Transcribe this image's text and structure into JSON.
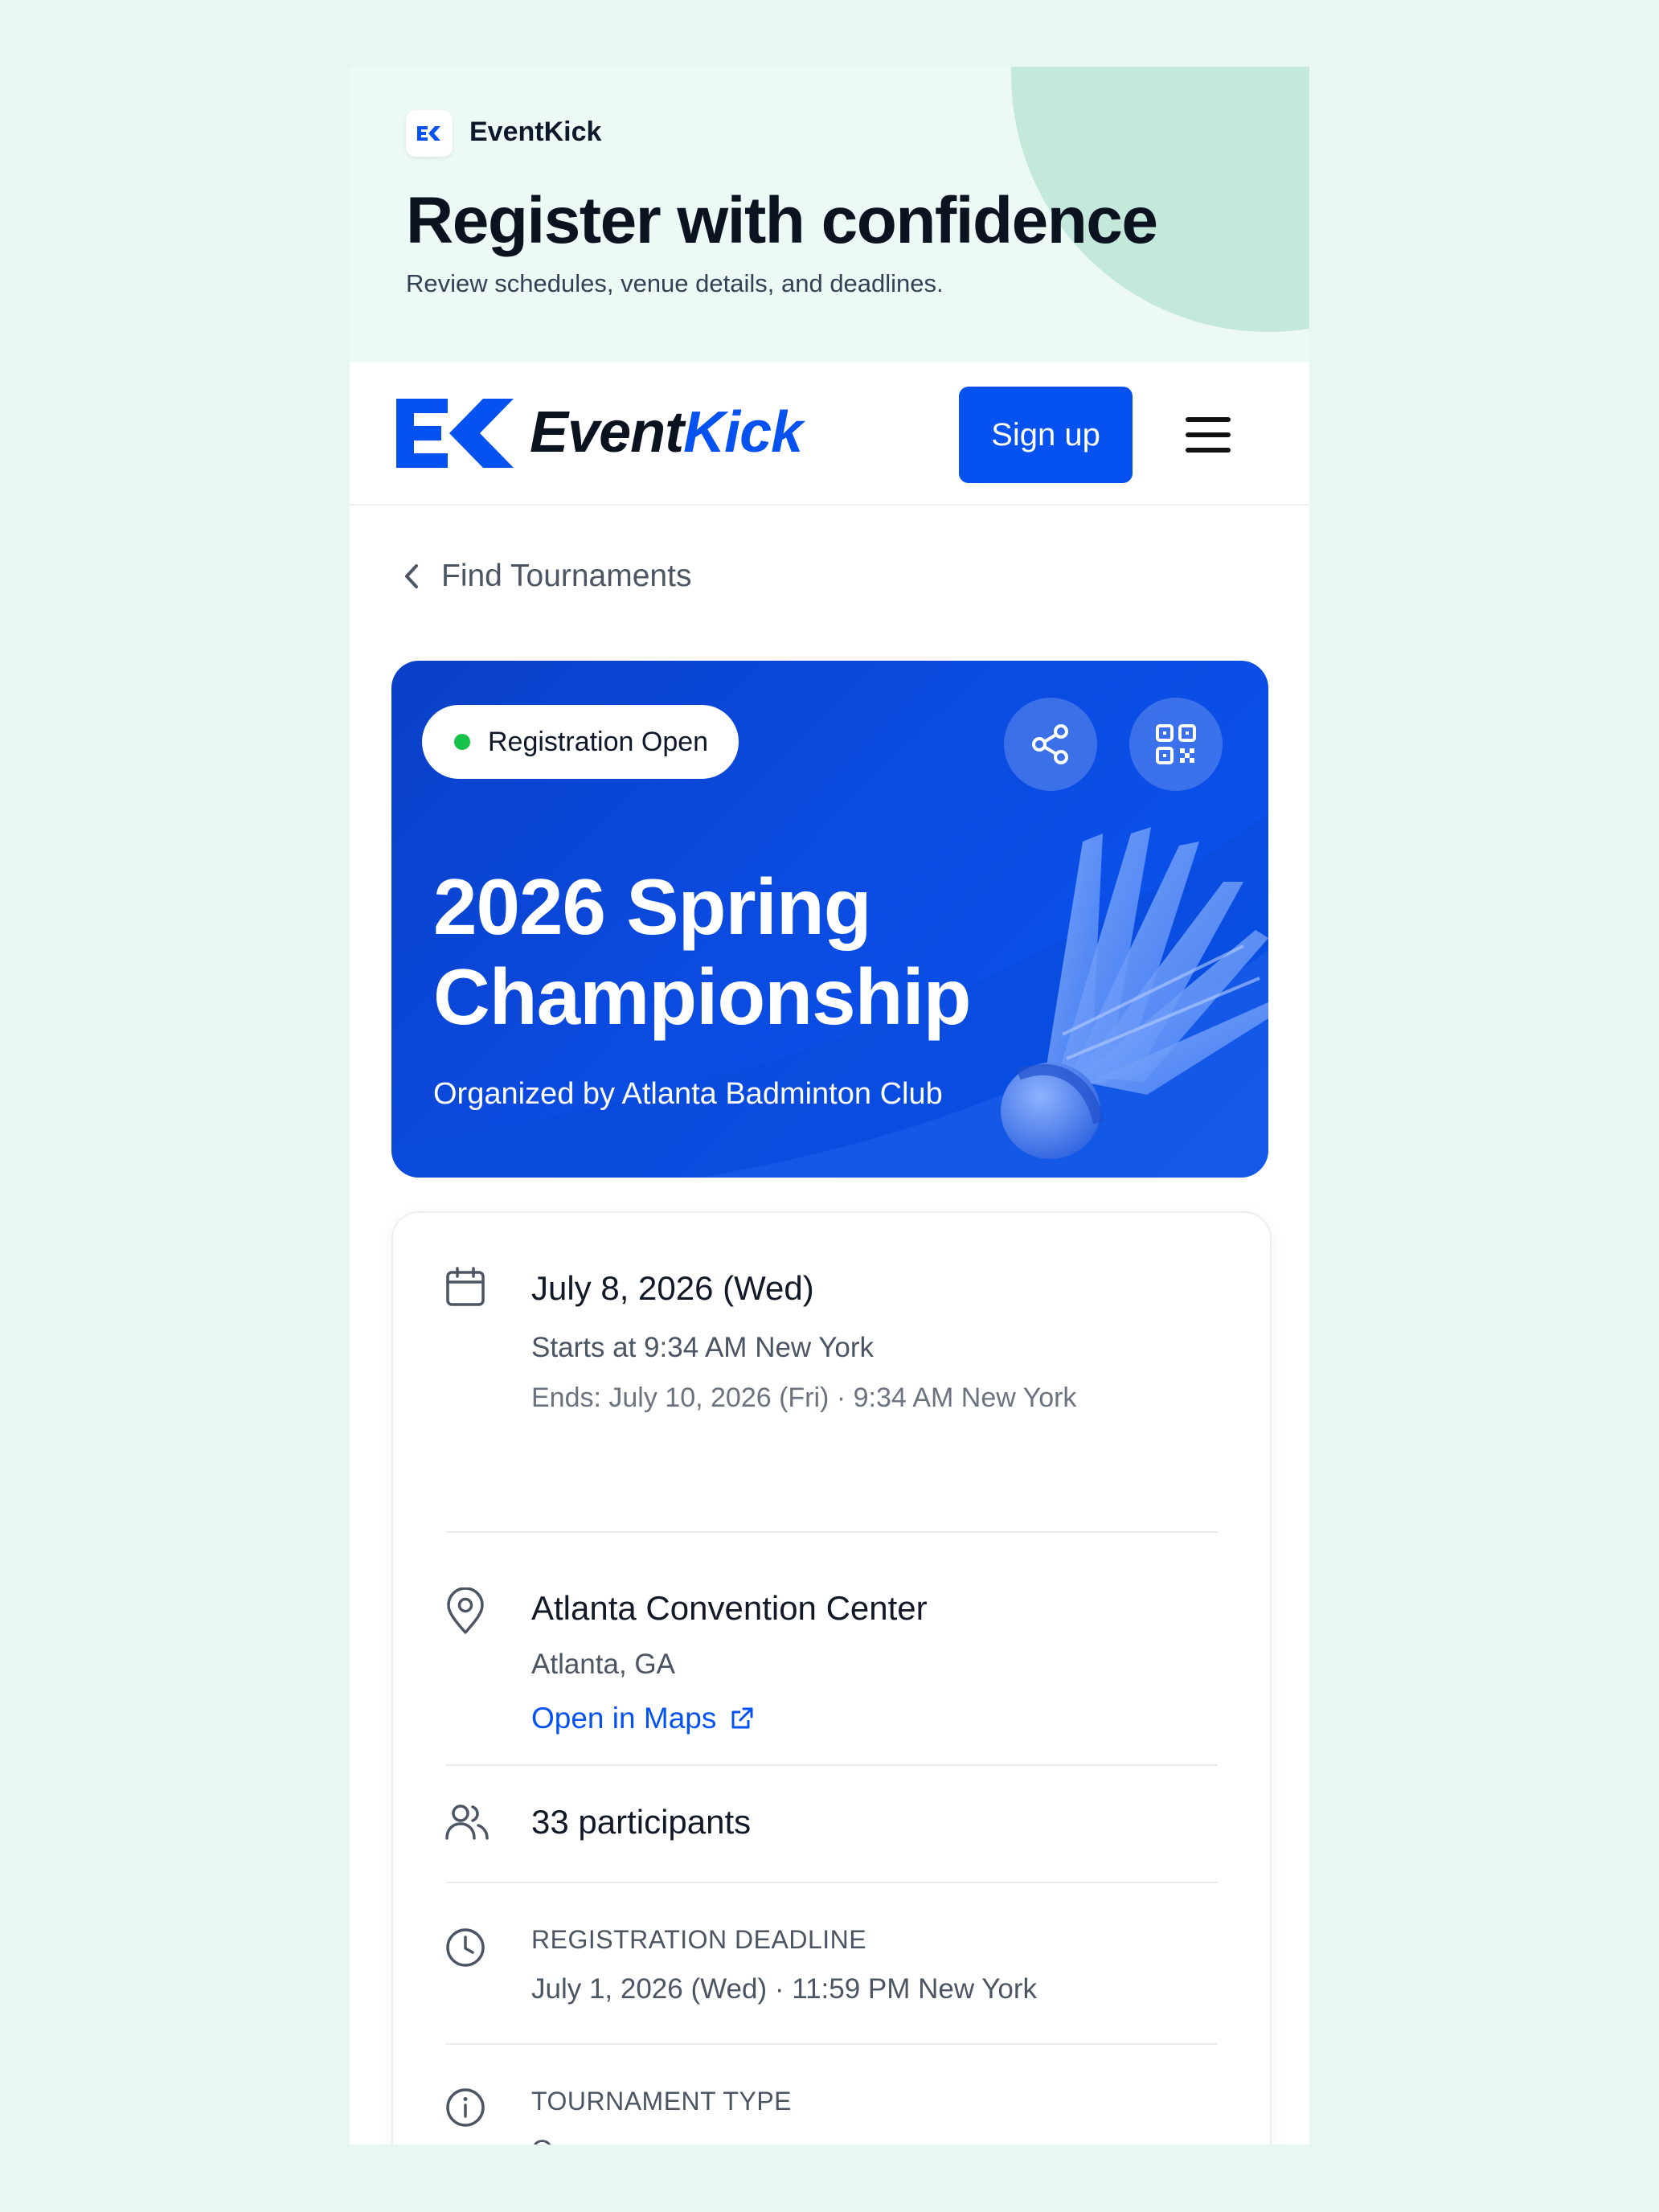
{
  "promo": {
    "brand": "EventKick",
    "logo_text": "EK",
    "title": "Register with confidence",
    "subtitle": "Review schedules, venue details, and deadlines."
  },
  "nav": {
    "brand_event": "Event",
    "brand_kick": "Kick",
    "signup_label": "Sign up",
    "menu_icon": "hamburger-icon"
  },
  "breadcrumb": {
    "label": "Find Tournaments",
    "icon": "chevron-left-icon"
  },
  "hero": {
    "status_badge": "Registration Open",
    "status_color": "#16c247",
    "title_line1": "2026 Spring",
    "title_line2": "Championship",
    "organizer": "Organized by Atlanta Badminton Club",
    "share_icon": "share-icon",
    "qr_icon": "qr-code-icon",
    "accent": "#0652f0"
  },
  "details": {
    "date": {
      "icon": "calendar-icon",
      "title": "July 8, 2026 (Wed)",
      "starts": "Starts at 9:34 AM New York",
      "ends": "Ends: July 10, 2026 (Fri) · 9:34 AM New York"
    },
    "venue": {
      "icon": "map-pin-icon",
      "name": "Atlanta Convention Center",
      "city": "Atlanta, GA",
      "maps_link": "Open in Maps",
      "link_icon": "external-link-icon"
    },
    "participants": {
      "icon": "users-icon",
      "label": "33 participants"
    },
    "deadline": {
      "icon": "clock-icon",
      "label": "REGISTRATION DEADLINE",
      "value": "July 1, 2026 (Wed) · 11:59 PM New York"
    },
    "type": {
      "icon": "info-icon",
      "label": "TOURNAMENT TYPE",
      "value": "Open"
    }
  }
}
